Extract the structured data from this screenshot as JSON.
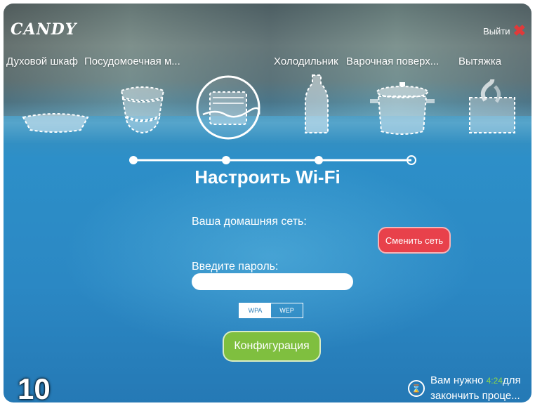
{
  "header": {
    "brand": "CANDY",
    "exit_label": "Выйти"
  },
  "categories": [
    {
      "label": "Духовой шкаф",
      "icon": "baking-dish-icon"
    },
    {
      "label": "Посудомоечная м...",
      "icon": "stacked-bowls-icon"
    },
    {
      "label": "",
      "icon": "washing-machine-icon",
      "selected": true
    },
    {
      "label": "Холодильник",
      "icon": "bottle-icon"
    },
    {
      "label": "Варочная поверх...",
      "icon": "cooking-pot-icon"
    },
    {
      "label": "Вытяжка",
      "icon": "steam-hood-icon"
    }
  ],
  "progress": {
    "steps": 4,
    "completed": 3
  },
  "wifi_setup": {
    "title": "Настроить Wi-Fi",
    "home_network_label": "Ваша домашняя сеть:",
    "change_network_button": "Сменить сеть",
    "password_label": "Введите пароль:",
    "password_value": "",
    "security_options": [
      "WPA",
      "WEP"
    ],
    "security_selected": "WPA",
    "configure_button": "Конфигурация"
  },
  "footer": {
    "step_number": "10",
    "timer_prefix": "Вам нужно ",
    "timer_value": "4:24",
    "timer_suffix": "для",
    "timer_line2": "закончить проце..."
  },
  "colors": {
    "accent_red": "#e8414b",
    "accent_green": "#7fbf3f",
    "timer_green": "#8fd84a",
    "background_blue": "#2b88c4"
  }
}
